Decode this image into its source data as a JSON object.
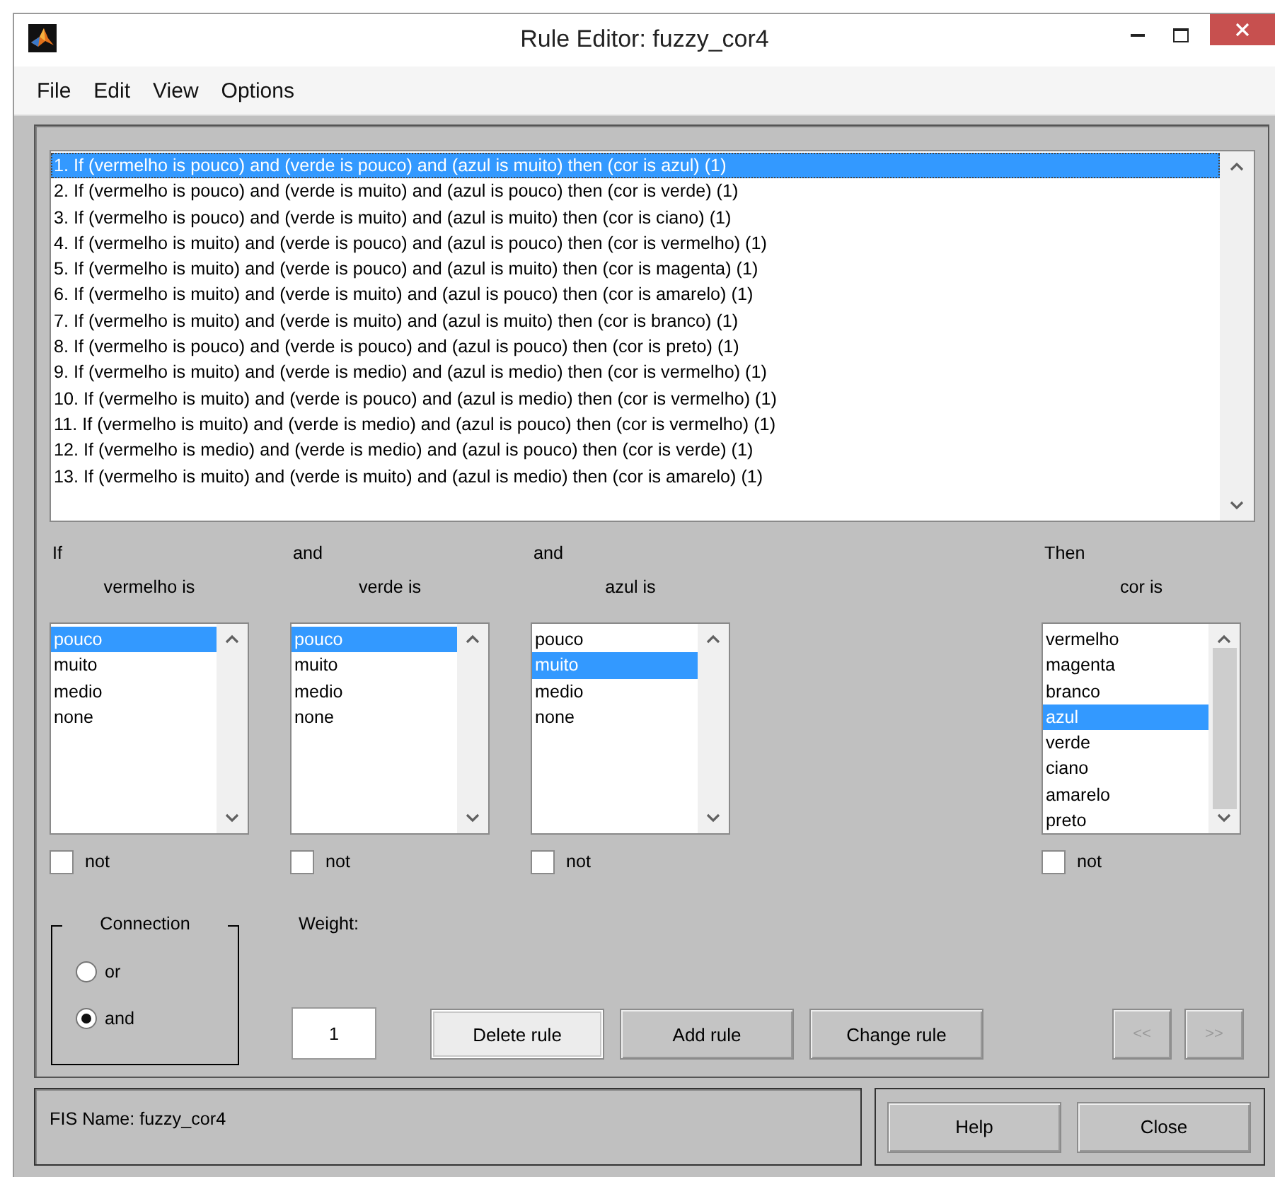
{
  "window": {
    "title": "Rule Editor: fuzzy_cor4"
  },
  "menu": [
    "File",
    "Edit",
    "View",
    "Options"
  ],
  "rules": [
    {
      "text": "1. If (vermelho is pouco) and (verde is pouco) and (azul is muito) then (cor is azul) (1)",
      "selected": true
    },
    {
      "text": "2. If (vermelho is pouco) and (verde is muito) and (azul is pouco) then (cor is verde) (1)",
      "selected": false
    },
    {
      "text": "3. If (vermelho is pouco) and (verde is muito) and (azul is muito) then (cor is ciano) (1)",
      "selected": false
    },
    {
      "text": "4. If (vermelho is muito) and (verde is pouco) and (azul is pouco) then (cor is vermelho) (1)",
      "selected": false
    },
    {
      "text": "5. If (vermelho is muito) and (verde is pouco) and (azul is muito) then (cor is magenta) (1)",
      "selected": false
    },
    {
      "text": "6. If (vermelho is muito) and (verde is muito) and (azul is pouco) then (cor is amarelo) (1)",
      "selected": false
    },
    {
      "text": "7. If (vermelho is muito) and (verde is muito) and (azul is muito) then (cor is branco) (1)",
      "selected": false
    },
    {
      "text": "8. If (vermelho is pouco) and (verde is pouco) and (azul is pouco) then (cor is preto) (1)",
      "selected": false
    },
    {
      "text": "9. If (vermelho is muito) and (verde is medio) and (azul is medio) then (cor is vermelho) (1)",
      "selected": false
    },
    {
      "text": "10. If (vermelho is muito) and (verde is pouco) and (azul is medio) then (cor is vermelho) (1)",
      "selected": false
    },
    {
      "text": "11. If (vermelho is muito) and (verde is medio) and (azul is pouco) then (cor is vermelho) (1)",
      "selected": false
    },
    {
      "text": "12. If (vermelho is medio) and (verde is medio) and (azul is pouco) then (cor is verde) (1)",
      "selected": false
    },
    {
      "text": "13. If (vermelho is muito) and (verde is muito) and (azul is medio) then (cor is amarelo) (1)",
      "selected": false
    }
  ],
  "inputs": [
    {
      "connector": "If",
      "label": "vermelho is",
      "not_label": "not",
      "not": false,
      "options": [
        {
          "label": "pouco",
          "selected": true
        },
        {
          "label": "muito",
          "selected": false
        },
        {
          "label": "medio",
          "selected": false
        },
        {
          "label": "none",
          "selected": false
        }
      ]
    },
    {
      "connector": "and",
      "label": "verde is",
      "not_label": "not",
      "not": false,
      "options": [
        {
          "label": "pouco",
          "selected": true
        },
        {
          "label": "muito",
          "selected": false
        },
        {
          "label": "medio",
          "selected": false
        },
        {
          "label": "none",
          "selected": false
        }
      ]
    },
    {
      "connector": "and",
      "label": "azul is",
      "not_label": "not",
      "not": false,
      "options": [
        {
          "label": "pouco",
          "selected": false
        },
        {
          "label": "muito",
          "selected": true
        },
        {
          "label": "medio",
          "selected": false
        },
        {
          "label": "none",
          "selected": false
        }
      ]
    }
  ],
  "output": {
    "connector": "Then",
    "label": "cor is",
    "not_label": "not",
    "not": false,
    "options": [
      {
        "label": "vermelho",
        "selected": false
      },
      {
        "label": "magenta",
        "selected": false
      },
      {
        "label": "branco",
        "selected": false
      },
      {
        "label": "azul",
        "selected": true
      },
      {
        "label": "verde",
        "selected": false
      },
      {
        "label": "ciano",
        "selected": false
      },
      {
        "label": "amarelo",
        "selected": false
      },
      {
        "label": "preto",
        "selected": false
      }
    ]
  },
  "connection": {
    "title": "Connection",
    "options": [
      {
        "label": "or",
        "selected": false
      },
      {
        "label": "and",
        "selected": true
      }
    ]
  },
  "weight": {
    "label": "Weight:",
    "value": "1"
  },
  "buttons": [
    {
      "label": "Delete rule",
      "focused": true
    },
    {
      "label": "Add rule",
      "focused": false
    },
    {
      "label": "Change rule",
      "focused": false
    }
  ],
  "nav_buttons": [
    {
      "label": "<<",
      "disabled": true
    },
    {
      "label": ">>",
      "disabled": true
    }
  ],
  "status": "FIS Name: fuzzy_cor4",
  "footer_buttons": [
    "Help",
    "Close"
  ]
}
